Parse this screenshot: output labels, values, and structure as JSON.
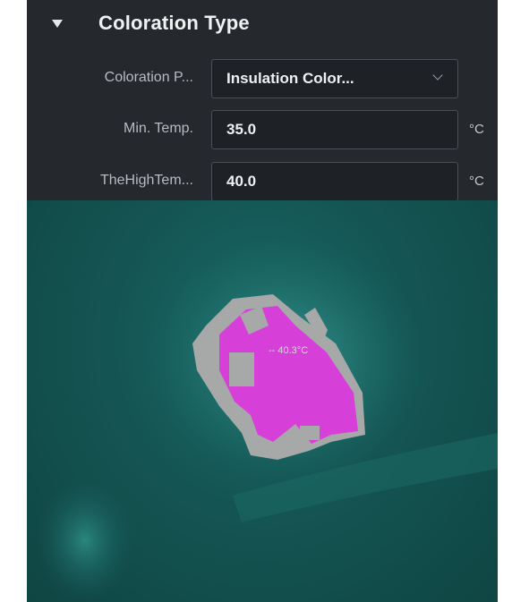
{
  "section": {
    "title": "Coloration Type"
  },
  "fields": {
    "coloration_palette": {
      "label": "Coloration P...",
      "value": "Insulation Color..."
    },
    "min_temp": {
      "label": "Min. Temp.",
      "value": "35.0",
      "unit": "°C"
    },
    "high_temp": {
      "label": "TheHighTem...",
      "value": "40.0",
      "unit": "°C"
    }
  },
  "thermal_view": {
    "readout": "-- 40.3°C",
    "colors": {
      "background": "#145553",
      "hot_region": "#d63fd8",
      "warm_region": "#a7a8a8"
    }
  }
}
